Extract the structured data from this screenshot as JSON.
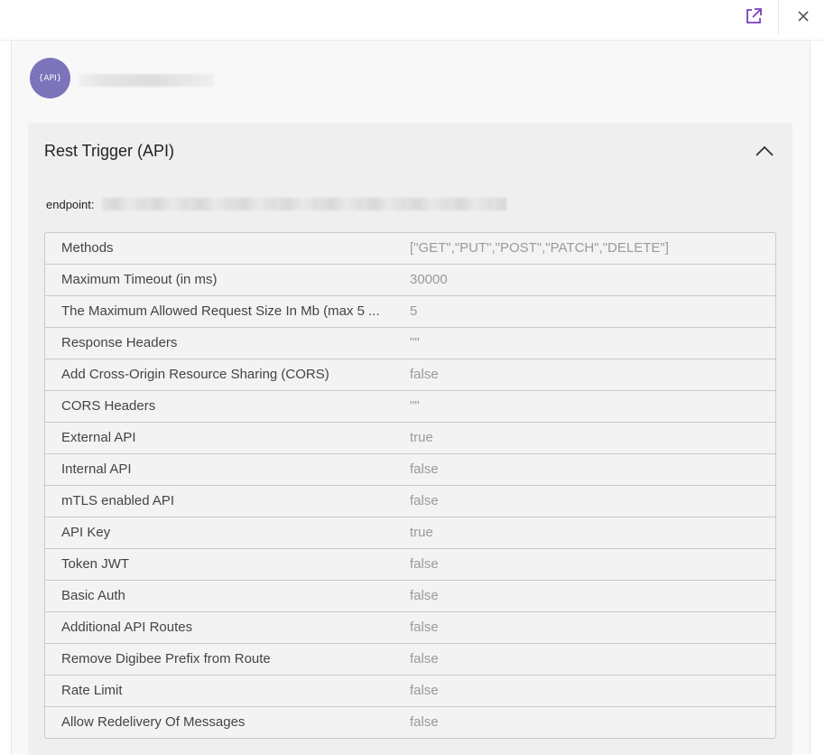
{
  "toolbar": {
    "external_icon": "external-link-icon",
    "close_icon": "close-icon",
    "accent": "#7b3fbf"
  },
  "header": {
    "avatar_text": "{API}",
    "avatar_color": "#7c74bb"
  },
  "section": {
    "title": "Rest Trigger (API)",
    "toggle_icon": "chevron-up-icon",
    "endpoint_label": "endpoint:"
  },
  "table": {
    "rows": [
      {
        "key": "Methods",
        "value": "[\"GET\",\"PUT\",\"POST\",\"PATCH\",\"DELETE\"]"
      },
      {
        "key": "Maximum Timeout (in ms)",
        "value": "30000"
      },
      {
        "key": "The Maximum Allowed Request Size In Mb (max 5 ...",
        "value": "5"
      },
      {
        "key": "Response Headers",
        "value": "\"\""
      },
      {
        "key": "Add Cross-Origin Resource Sharing (CORS)",
        "value": "false"
      },
      {
        "key": "CORS Headers",
        "value": "\"\""
      },
      {
        "key": "External API",
        "value": "true"
      },
      {
        "key": "Internal API",
        "value": "false"
      },
      {
        "key": "mTLS enabled API",
        "value": "false"
      },
      {
        "key": "API Key",
        "value": "true"
      },
      {
        "key": "Token JWT",
        "value": "false"
      },
      {
        "key": "Basic Auth",
        "value": "false"
      },
      {
        "key": "Additional API Routes",
        "value": "false"
      },
      {
        "key": "Remove Digibee Prefix from Route",
        "value": "false"
      },
      {
        "key": "Rate Limit",
        "value": "false"
      },
      {
        "key": "Allow Redelivery Of Messages",
        "value": "false"
      }
    ]
  }
}
